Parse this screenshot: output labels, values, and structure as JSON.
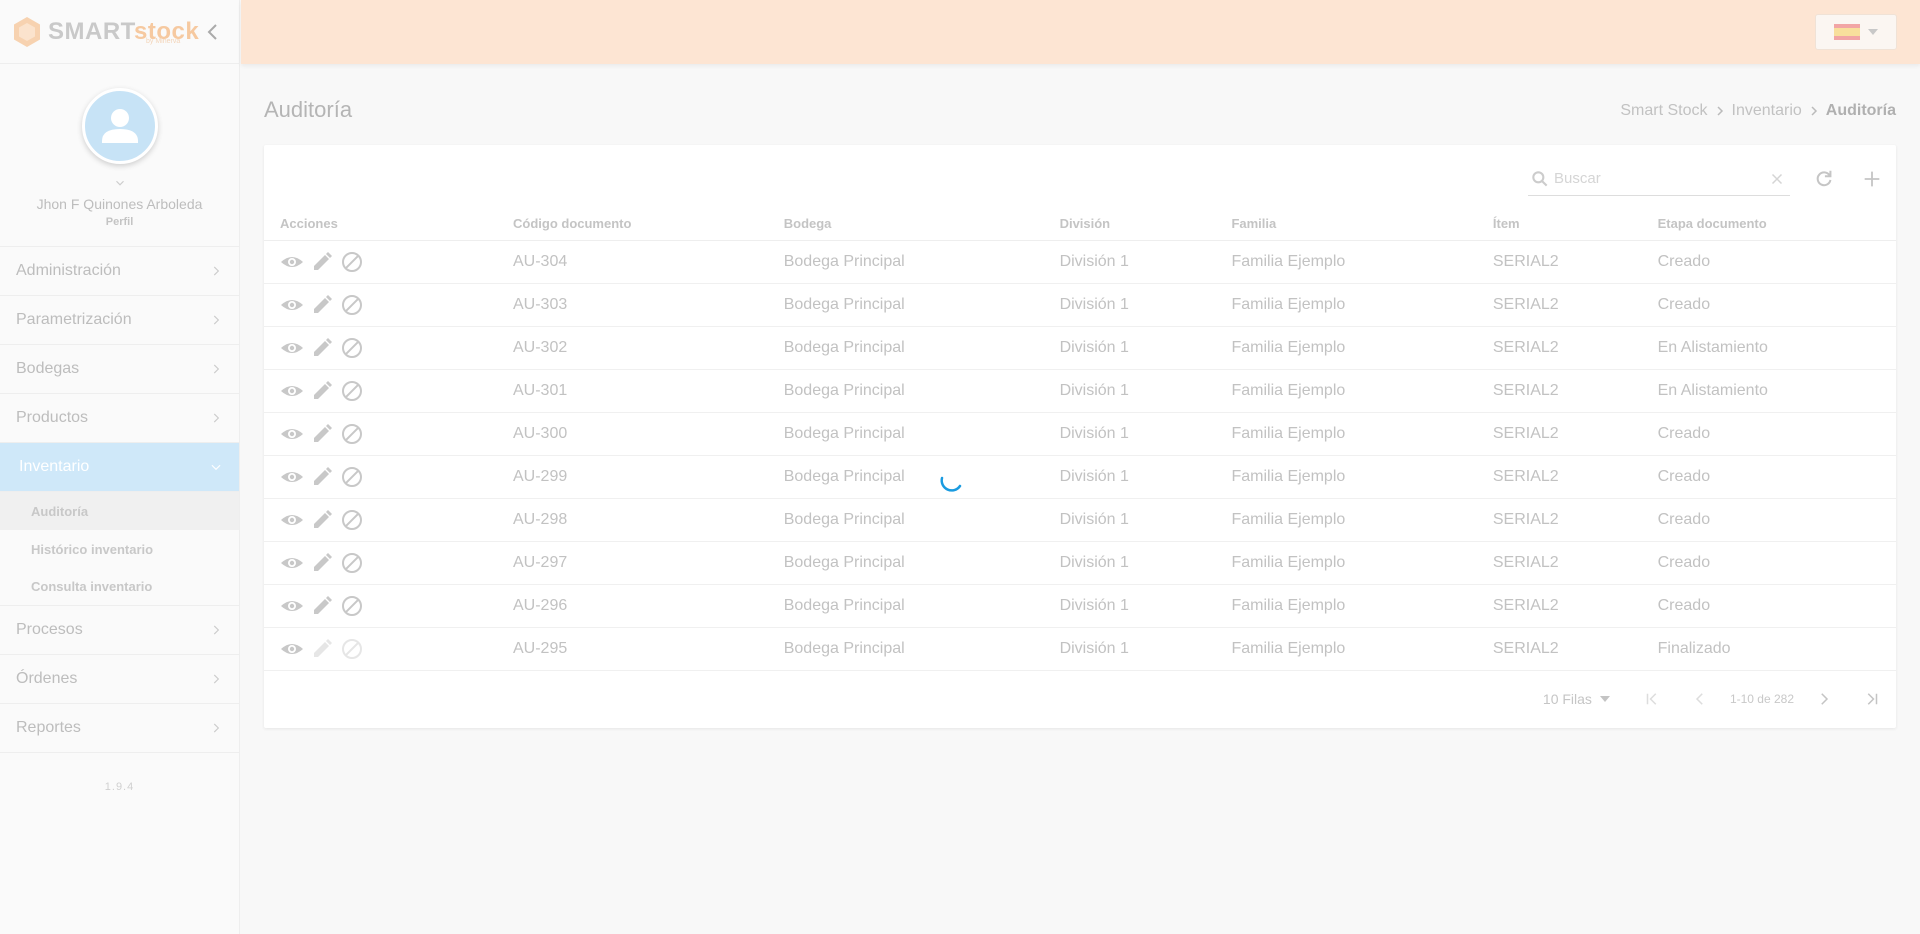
{
  "app": {
    "logo_smart": "SMART",
    "logo_stock": "stock",
    "logo_sub": "by Minerva"
  },
  "profile": {
    "name": "Jhon F Quinones Arboleda",
    "role": "Perfil"
  },
  "menu": {
    "items": [
      {
        "label": "Administración"
      },
      {
        "label": "Parametrización"
      },
      {
        "label": "Bodegas"
      },
      {
        "label": "Productos"
      },
      {
        "label": "Inventario"
      },
      {
        "label": "Procesos"
      },
      {
        "label": "Órdenes"
      },
      {
        "label": "Reportes"
      }
    ],
    "submenu": [
      {
        "label": "Auditoría"
      },
      {
        "label": "Histórico inventario"
      },
      {
        "label": "Consulta inventario"
      }
    ],
    "version": "1.9.4"
  },
  "page": {
    "title": "Auditoría",
    "breadcrumb": [
      "Smart Stock",
      "Inventario",
      "Auditoría"
    ]
  },
  "search": {
    "placeholder": "Buscar",
    "value": ""
  },
  "table": {
    "headers": [
      "Acciones",
      "Código documento",
      "Bodega",
      "División",
      "Familia",
      "Ítem",
      "Etapa documento"
    ],
    "rows": [
      {
        "codigo": "AU-304",
        "bodega": "Bodega Principal",
        "division": "División 1",
        "familia": "Familia Ejemplo",
        "item": "SERIAL2",
        "etapa": "Creado"
      },
      {
        "codigo": "AU-303",
        "bodega": "Bodega Principal",
        "division": "División 1",
        "familia": "Familia Ejemplo",
        "item": "SERIAL2",
        "etapa": "Creado"
      },
      {
        "codigo": "AU-302",
        "bodega": "Bodega Principal",
        "division": "División 1",
        "familia": "Familia Ejemplo",
        "item": "SERIAL2",
        "etapa": "En Alistamiento"
      },
      {
        "codigo": "AU-301",
        "bodega": "Bodega Principal",
        "division": "División 1",
        "familia": "Familia Ejemplo",
        "item": "SERIAL2",
        "etapa": "En Alistamiento"
      },
      {
        "codigo": "AU-300",
        "bodega": "Bodega Principal",
        "division": "División 1",
        "familia": "Familia Ejemplo",
        "item": "SERIAL2",
        "etapa": "Creado"
      },
      {
        "codigo": "AU-299",
        "bodega": "Bodega Principal",
        "division": "División 1",
        "familia": "Familia Ejemplo",
        "item": "SERIAL2",
        "etapa": "Creado"
      },
      {
        "codigo": "AU-298",
        "bodega": "Bodega Principal",
        "division": "División 1",
        "familia": "Familia Ejemplo",
        "item": "SERIAL2",
        "etapa": "Creado"
      },
      {
        "codigo": "AU-297",
        "bodega": "Bodega Principal",
        "division": "División 1",
        "familia": "Familia Ejemplo",
        "item": "SERIAL2",
        "etapa": "Creado"
      },
      {
        "codigo": "AU-296",
        "bodega": "Bodega Principal",
        "division": "División 1",
        "familia": "Familia Ejemplo",
        "item": "SERIAL2",
        "etapa": "Creado"
      },
      {
        "codigo": "AU-295",
        "bodega": "Bodega Principal",
        "division": "División 1",
        "familia": "Familia Ejemplo",
        "item": "SERIAL2",
        "etapa": "Finalizado"
      }
    ]
  },
  "pager": {
    "rows_label": "10 Filas",
    "range": "1-10 de 282"
  },
  "colors": {
    "topbar": "#fde5d3",
    "active_menu": "#cfe8f9",
    "spinner": "#1a9be0"
  },
  "icons": [
    "chevron-left-icon",
    "person-icon",
    "chevron-down-icon",
    "chevron-right-icon",
    "spain-flag-icon",
    "search-icon",
    "close-icon",
    "refresh-icon",
    "plus-icon",
    "eye-icon",
    "pencil-icon",
    "block-icon",
    "first-page-icon",
    "last-page-icon"
  ]
}
